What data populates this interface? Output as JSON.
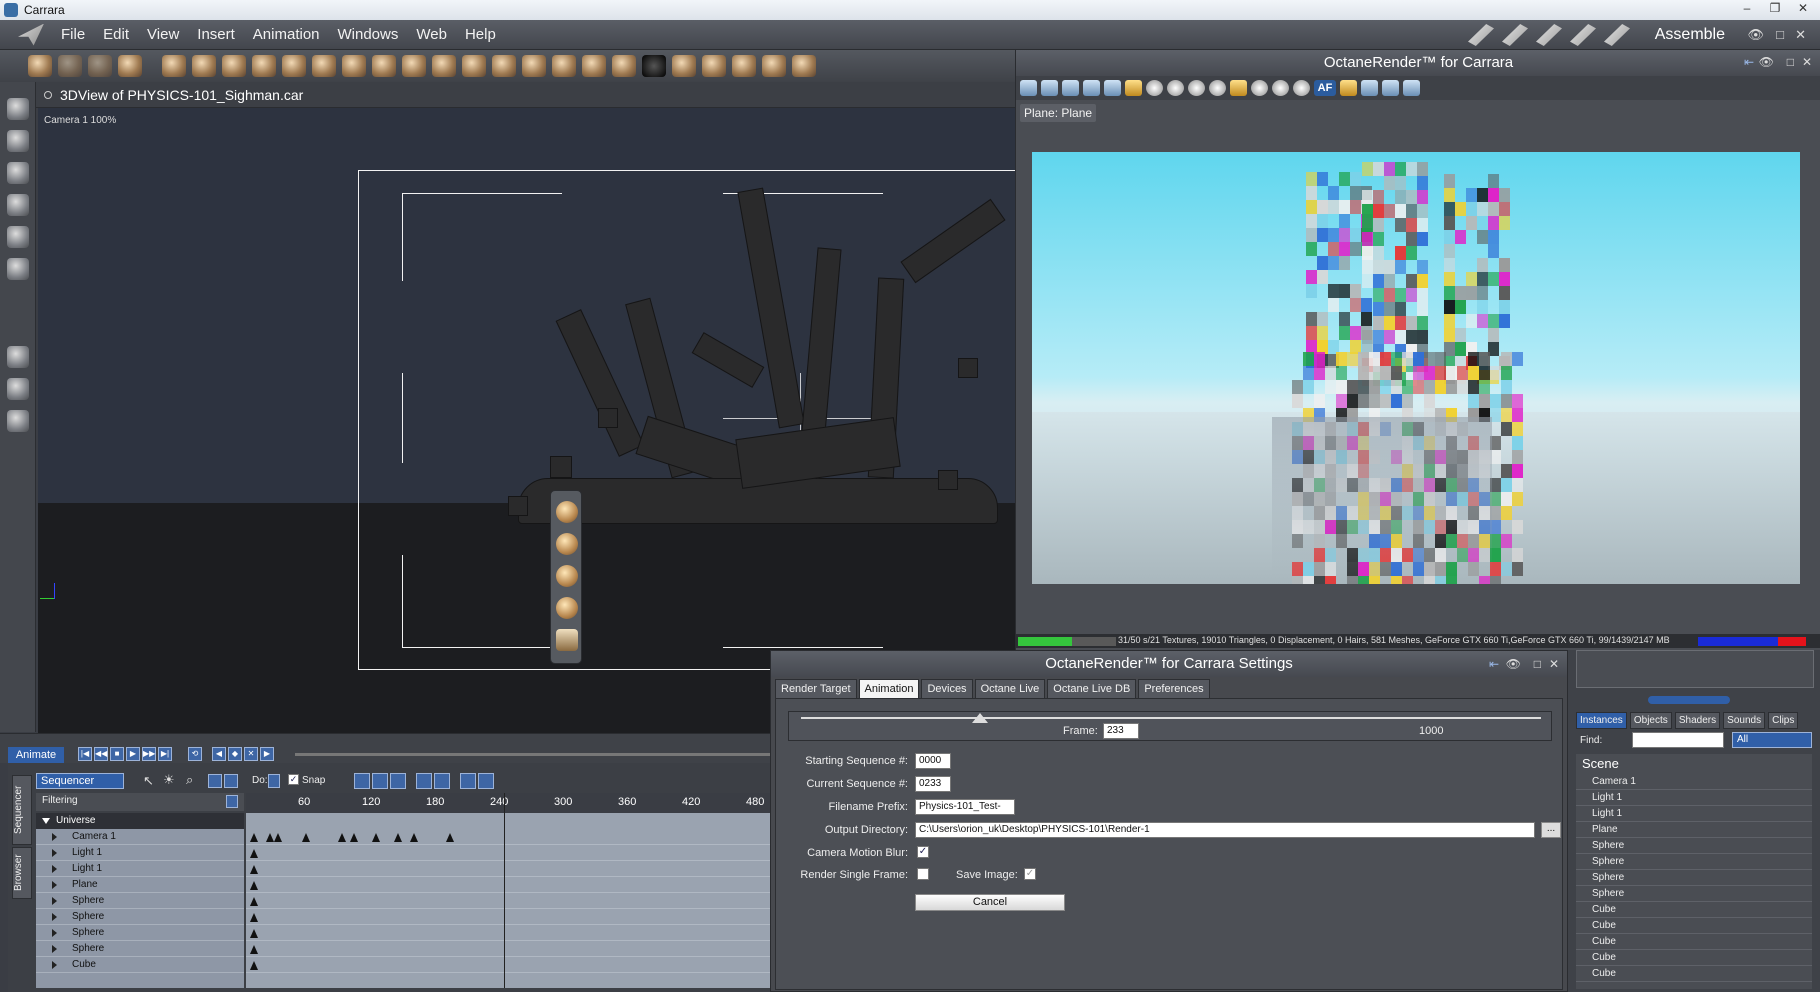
{
  "app": {
    "title": "Carrara"
  },
  "menu": [
    "File",
    "Edit",
    "View",
    "Insert",
    "Animation",
    "Windows",
    "Web",
    "Help"
  ],
  "room": "Assemble",
  "view3d": {
    "title": "3DView of PHYSICS-101_Sighman.car",
    "camera_label": "Camera 1 100%"
  },
  "octane": {
    "title": "OctaneRender™ for Carrara",
    "af_label": "AF",
    "selection": "Plane: Plane",
    "status_text": "31/50 s/21 Textures, 19010 Triangles, 0 Displacement, 0 Hairs, 581 Meshes, GeForce GTX 660 Ti,GeForce GTX 660 Ti, 99/1439/2147 MB",
    "progress": 0.55,
    "colors": {
      "accent": "#305fa8",
      "progress": "#35c53d",
      "vram_used": "#e5131b",
      "vram_free": "#1a2bd8"
    }
  },
  "settings": {
    "title": "OctaneRender™ for Carrara Settings",
    "tabs": [
      "Render Target",
      "Animation",
      "Devices",
      "Octane Live",
      "Octane Live DB",
      "Preferences"
    ],
    "active_tab": "Animation",
    "frame_label": "Frame:",
    "frame_value": "233",
    "frame_max": "1000",
    "start_seq_label": "Starting Sequence #:",
    "start_seq_value": "0000",
    "current_seq_label": "Current Sequence #:",
    "current_seq_value": "0233",
    "prefix_label": "Filename Prefix:",
    "prefix_value": "Physics-101_Test-",
    "outdir_label": "Output Directory:",
    "outdir_value": "C:\\Users\\orion_uk\\Desktop\\PHYSICS-101\\Render-1",
    "browse_label": "...",
    "motion_blur_label": "Camera Motion Blur:",
    "single_frame_label": "Render Single Frame:",
    "save_image_label": "Save Image:",
    "cancel_label": "Cancel"
  },
  "sequencer": {
    "animate_label": "Animate",
    "mode": "Sequencer",
    "do_label": "Do:",
    "snap_label": "Snap",
    "filtering_label": "Filtering",
    "side_tabs": [
      "Sequencer",
      "Browser"
    ],
    "universe_label": "Universe",
    "tracks": [
      "Camera 1",
      "Light 1",
      "Light 1",
      "Plane",
      "Sphere",
      "Sphere",
      "Sphere",
      "Sphere",
      "Cube"
    ],
    "ruler": [
      "60",
      "120",
      "180",
      "240",
      "300",
      "360",
      "420",
      "480"
    ]
  },
  "right_panel": {
    "tabs": [
      "Instances",
      "Objects",
      "Shaders",
      "Sounds",
      "Clips"
    ],
    "find_label": "Find:",
    "filter_value": "All",
    "scene_label": "Scene",
    "items": [
      "Camera 1",
      "Light 1",
      "Light 1",
      "Plane",
      "Sphere",
      "Sphere",
      "Sphere",
      "Sphere",
      "Cube",
      "Cube",
      "Cube",
      "Cube",
      "Cube"
    ]
  }
}
